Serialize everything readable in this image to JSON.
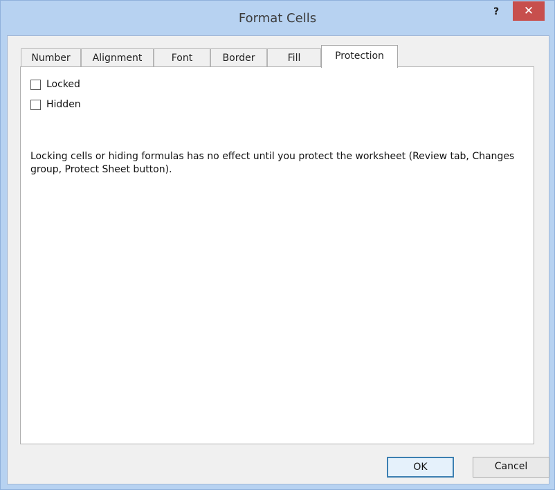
{
  "window": {
    "title": "Format Cells",
    "help_glyph": "?",
    "close_glyph": "✕"
  },
  "tabs": [
    {
      "label": "Number",
      "active": false
    },
    {
      "label": "Alignment",
      "active": false
    },
    {
      "label": "Font",
      "active": false
    },
    {
      "label": "Border",
      "active": false
    },
    {
      "label": "Fill",
      "active": false
    },
    {
      "label": "Protection",
      "active": true
    }
  ],
  "protection": {
    "locked": {
      "label": "Locked",
      "checked": false
    },
    "hidden": {
      "label": "Hidden",
      "checked": false
    },
    "note": "Locking cells or hiding formulas has no effect until you protect the worksheet (Review tab, Changes group, Protect Sheet button)."
  },
  "buttons": {
    "ok": "OK",
    "cancel": "Cancel"
  },
  "colors": {
    "frame": "#b7d2f1",
    "close_button": "#c74f4d",
    "default_button_border": "#3c7fb1"
  }
}
